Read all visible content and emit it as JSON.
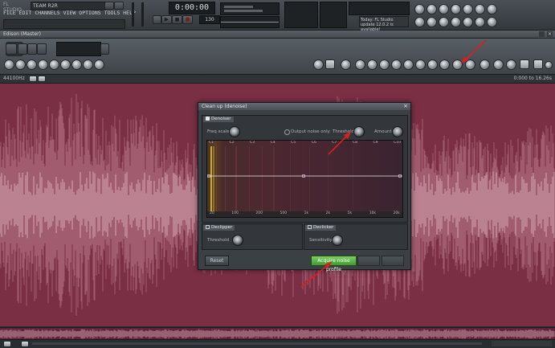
{
  "app": {
    "logo": "FL STUDIO",
    "project_title": "TEAM R2R",
    "menu": [
      "FILE",
      "EDIT",
      "CHANNELS",
      "VIEW",
      "OPTIONS",
      "TOOLS",
      "HELP"
    ],
    "time_display": "0:00:00",
    "tempo": "130",
    "news": "Today: FL Studio update 12.0.2 is available!"
  },
  "edison": {
    "window_title": "Edison (Master)",
    "sample_rate": "44100Hz",
    "selection_info": "0:000 to 16.26s"
  },
  "dialog": {
    "title": "Clean up (denoise)",
    "denoiser_section": "Denoiser",
    "freq_scale_label": "Freq scale",
    "output_noise_only_label": "Output noise only",
    "threshold_label": "Threshold",
    "amount_label": "Amount",
    "spectrum_top_ticks": [
      "C1",
      "C2",
      "C3",
      "C4",
      "C5",
      "C6",
      "C7",
      "C8",
      "C9",
      "C10"
    ],
    "spectrum_bottom_ticks": [
      "20",
      "100",
      "200",
      "500",
      "1k",
      "2k",
      "5k",
      "10k",
      "20k"
    ],
    "declipper_section": "Declipper",
    "declipper_threshold_label": "Threshold",
    "declicker_section": "Declicker",
    "sensitivity_label": "Sensitivity",
    "reset_button": "Reset",
    "acquire_button": "Acquire noise profile"
  },
  "colors": {
    "waveform_bg": "#7a2f45",
    "waveform_peak": "#f3b8c8",
    "accent_green": "#5cb544",
    "arrow_red": "#d42121"
  }
}
